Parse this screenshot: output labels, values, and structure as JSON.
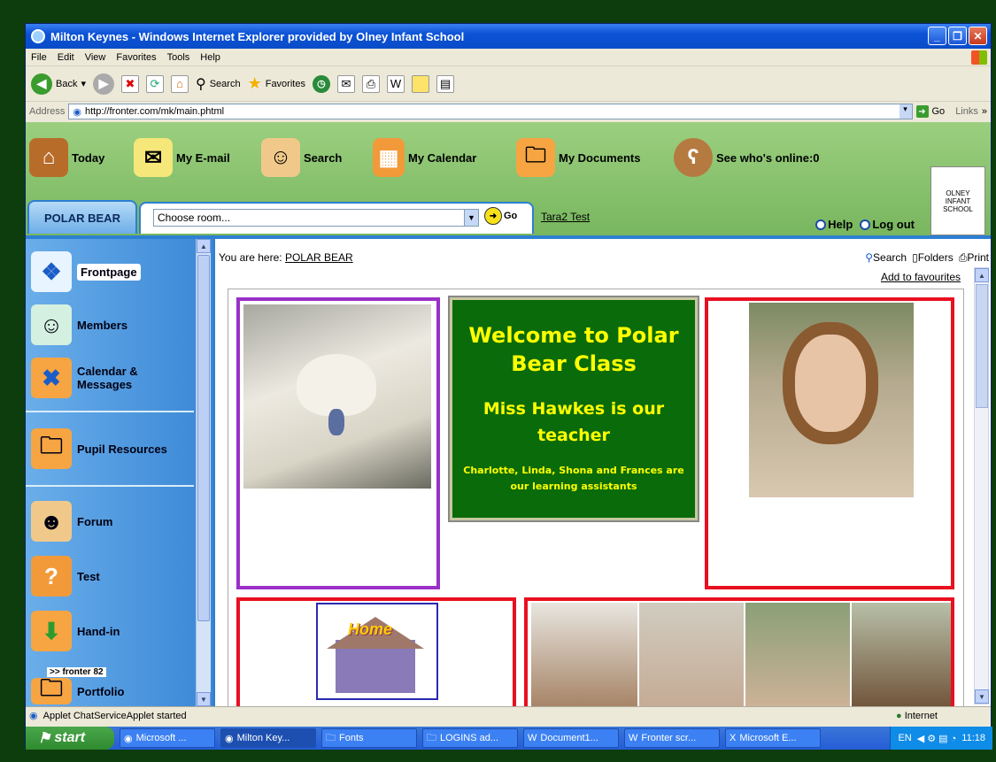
{
  "window": {
    "title": "Milton Keynes - Windows Internet Explorer provided by Olney Infant School"
  },
  "menu": [
    "File",
    "Edit",
    "View",
    "Favorites",
    "Tools",
    "Help"
  ],
  "toolbar": {
    "back": "Back",
    "search": "Search",
    "favorites": "Favorites"
  },
  "address": {
    "label": "Address",
    "url": "http://fronter.com/mk/main.phtml",
    "go": "Go",
    "links": "Links"
  },
  "nav": {
    "today": "Today",
    "email": "My E-mail",
    "search": "Search",
    "calendar": "My Calendar",
    "documents": "My Documents",
    "online": "See who's online:0"
  },
  "tab": {
    "room": "POLAR BEAR",
    "select_value": "Choose room...",
    "go": "Go",
    "user": "Tara2 Test",
    "help": "Help",
    "logout": "Log out"
  },
  "sidebar": {
    "items": [
      "Frontpage",
      "Members",
      "Calendar &\nMessages",
      "Pupil Resources",
      "Forum",
      "Test",
      "Hand-in",
      "Portfolio"
    ],
    "brand": ">> fronter 82"
  },
  "main": {
    "you_are_here": "You are here:",
    "crumb": "POLAR BEAR",
    "tools": [
      "Search",
      "Folders",
      "Print"
    ],
    "add_fav": "Add to favourites"
  },
  "welcome": {
    "line1": "Welcome to Polar Bear Class",
    "line2": "Miss Hawkes is our teacher",
    "line3": "Charlotte, Linda, Shona and Frances are our learning assistants"
  },
  "home_sign": "Home",
  "status": {
    "text": "Applet ChatServiceApplet started",
    "zone": "Internet"
  },
  "taskbar": {
    "start": "start",
    "tasks": [
      "Microsoft ...",
      "Milton Key...",
      "Fonts",
      "LOGINS ad...",
      "Document1...",
      "Fronter scr...",
      "Microsoft E..."
    ],
    "lang": "EN",
    "time": "11:18"
  },
  "colors": {
    "nav_green": "#78b65e",
    "sidebar_blue": "#3a87d6",
    "welcome_green": "#0a6b0a",
    "frame_purple": "#9b30c8",
    "frame_red": "#e81020"
  }
}
